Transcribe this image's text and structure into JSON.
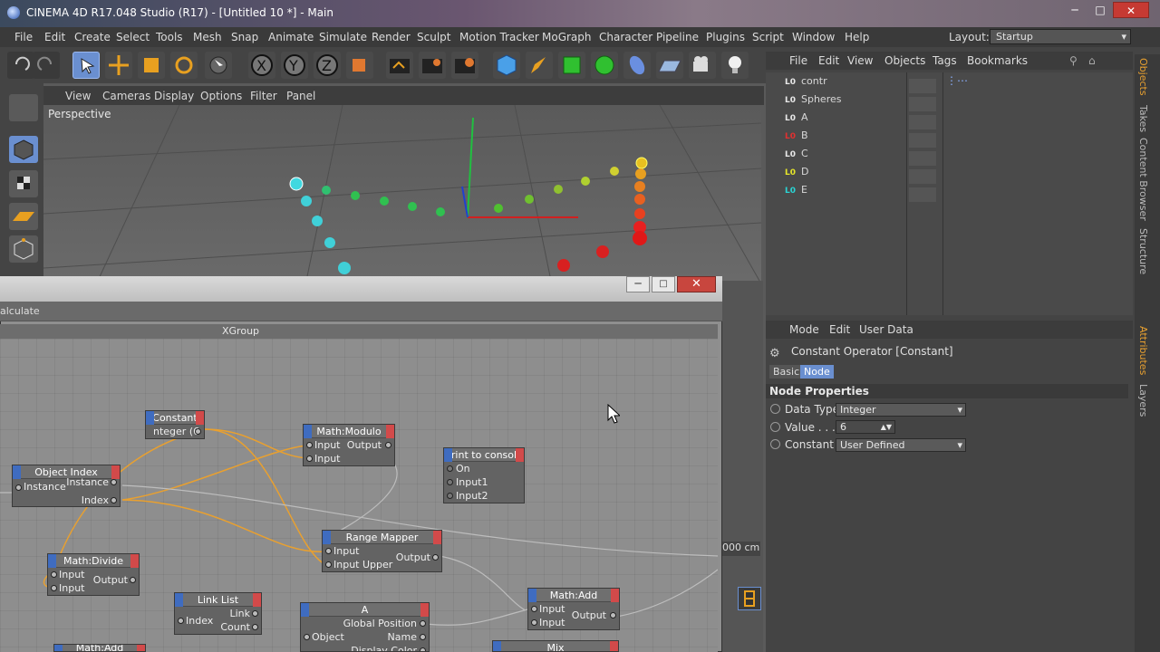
{
  "window": {
    "title": "CINEMA 4D R17.048 Studio (R17) - [Untitled 10 *] - Main"
  },
  "menubar": [
    "File",
    "Edit",
    "Create",
    "Select",
    "Tools",
    "Mesh",
    "Snap",
    "Animate",
    "Simulate",
    "Render",
    "Sculpt",
    "Motion Tracker",
    "MoGraph",
    "Character",
    "Pipeline",
    "Plugins",
    "Script",
    "Window",
    "Help"
  ],
  "layout": {
    "label": "Layout:",
    "value": "Startup"
  },
  "viewport": {
    "menu": [
      "View",
      "Cameras",
      "Display",
      "Options",
      "Filter",
      "Panel"
    ],
    "label": "Perspective"
  },
  "xpresso": {
    "menu_partial": "alculate",
    "group_title": "XGroup",
    "nodes": {
      "constant": {
        "title": "Constant",
        "port": "nteger (6"
      },
      "modulo": {
        "title": "Math:Modulo",
        "in1": "Input",
        "in2": "Input",
        "out": "Output"
      },
      "print": {
        "title": "rint to consol",
        "p1": "On",
        "p2": "Input1",
        "p3": "Input2"
      },
      "objindex": {
        "title": "Object Index",
        "in": "Instance",
        "out1": "Instance",
        "out2": "Index"
      },
      "divide": {
        "title": "Math:Divide",
        "in1": "Input",
        "in2": "Input",
        "out": "Output"
      },
      "range": {
        "title": "Range Mapper",
        "in1": "Input",
        "in2": "Input Upper",
        "out": "Output"
      },
      "linklist": {
        "title": "Link List",
        "in": "Index",
        "out1": "Link",
        "out2": "Count"
      },
      "a": {
        "title": "A",
        "in": "Object",
        "out1": "Global Position",
        "out2": "Name",
        "out3": "Display Color"
      },
      "add": {
        "title": "Math:Add",
        "in1": "Input",
        "in2": "Input",
        "out": "Output"
      },
      "mix": {
        "title": "Mix"
      },
      "add2": {
        "title": "Math:Add"
      }
    }
  },
  "coord": {
    "value": "000 cm"
  },
  "objects": {
    "menu": [
      "File",
      "Edit",
      "View",
      "Objects",
      "Tags",
      "Bookmarks"
    ],
    "items": [
      {
        "name": "contr",
        "color": "#e8e8e8"
      },
      {
        "name": "Spheres",
        "color": "#e8e8e8"
      },
      {
        "name": "A",
        "color": "#e8e8e8"
      },
      {
        "name": "B",
        "color": "#e23030"
      },
      {
        "name": "C",
        "color": "#e8e8e8"
      },
      {
        "name": "D",
        "color": "#e6e62a"
      },
      {
        "name": "E",
        "color": "#2ad4d4"
      }
    ],
    "lo": "L0"
  },
  "attributes": {
    "menu": [
      "Mode",
      "Edit",
      "User Data"
    ],
    "title": "Constant Operator [Constant]",
    "tabs": [
      "Basic",
      "Node"
    ],
    "section": "Node Properties",
    "props": [
      {
        "label": "Data Type",
        "value": "Integer"
      },
      {
        "label": "Value . . . .",
        "value": "6"
      },
      {
        "label": "Constant",
        "value": "User Defined"
      }
    ]
  },
  "sidetabs": [
    "Objects",
    "Takes",
    "Content Browser",
    "Structure",
    "Attributes",
    "Layers"
  ]
}
